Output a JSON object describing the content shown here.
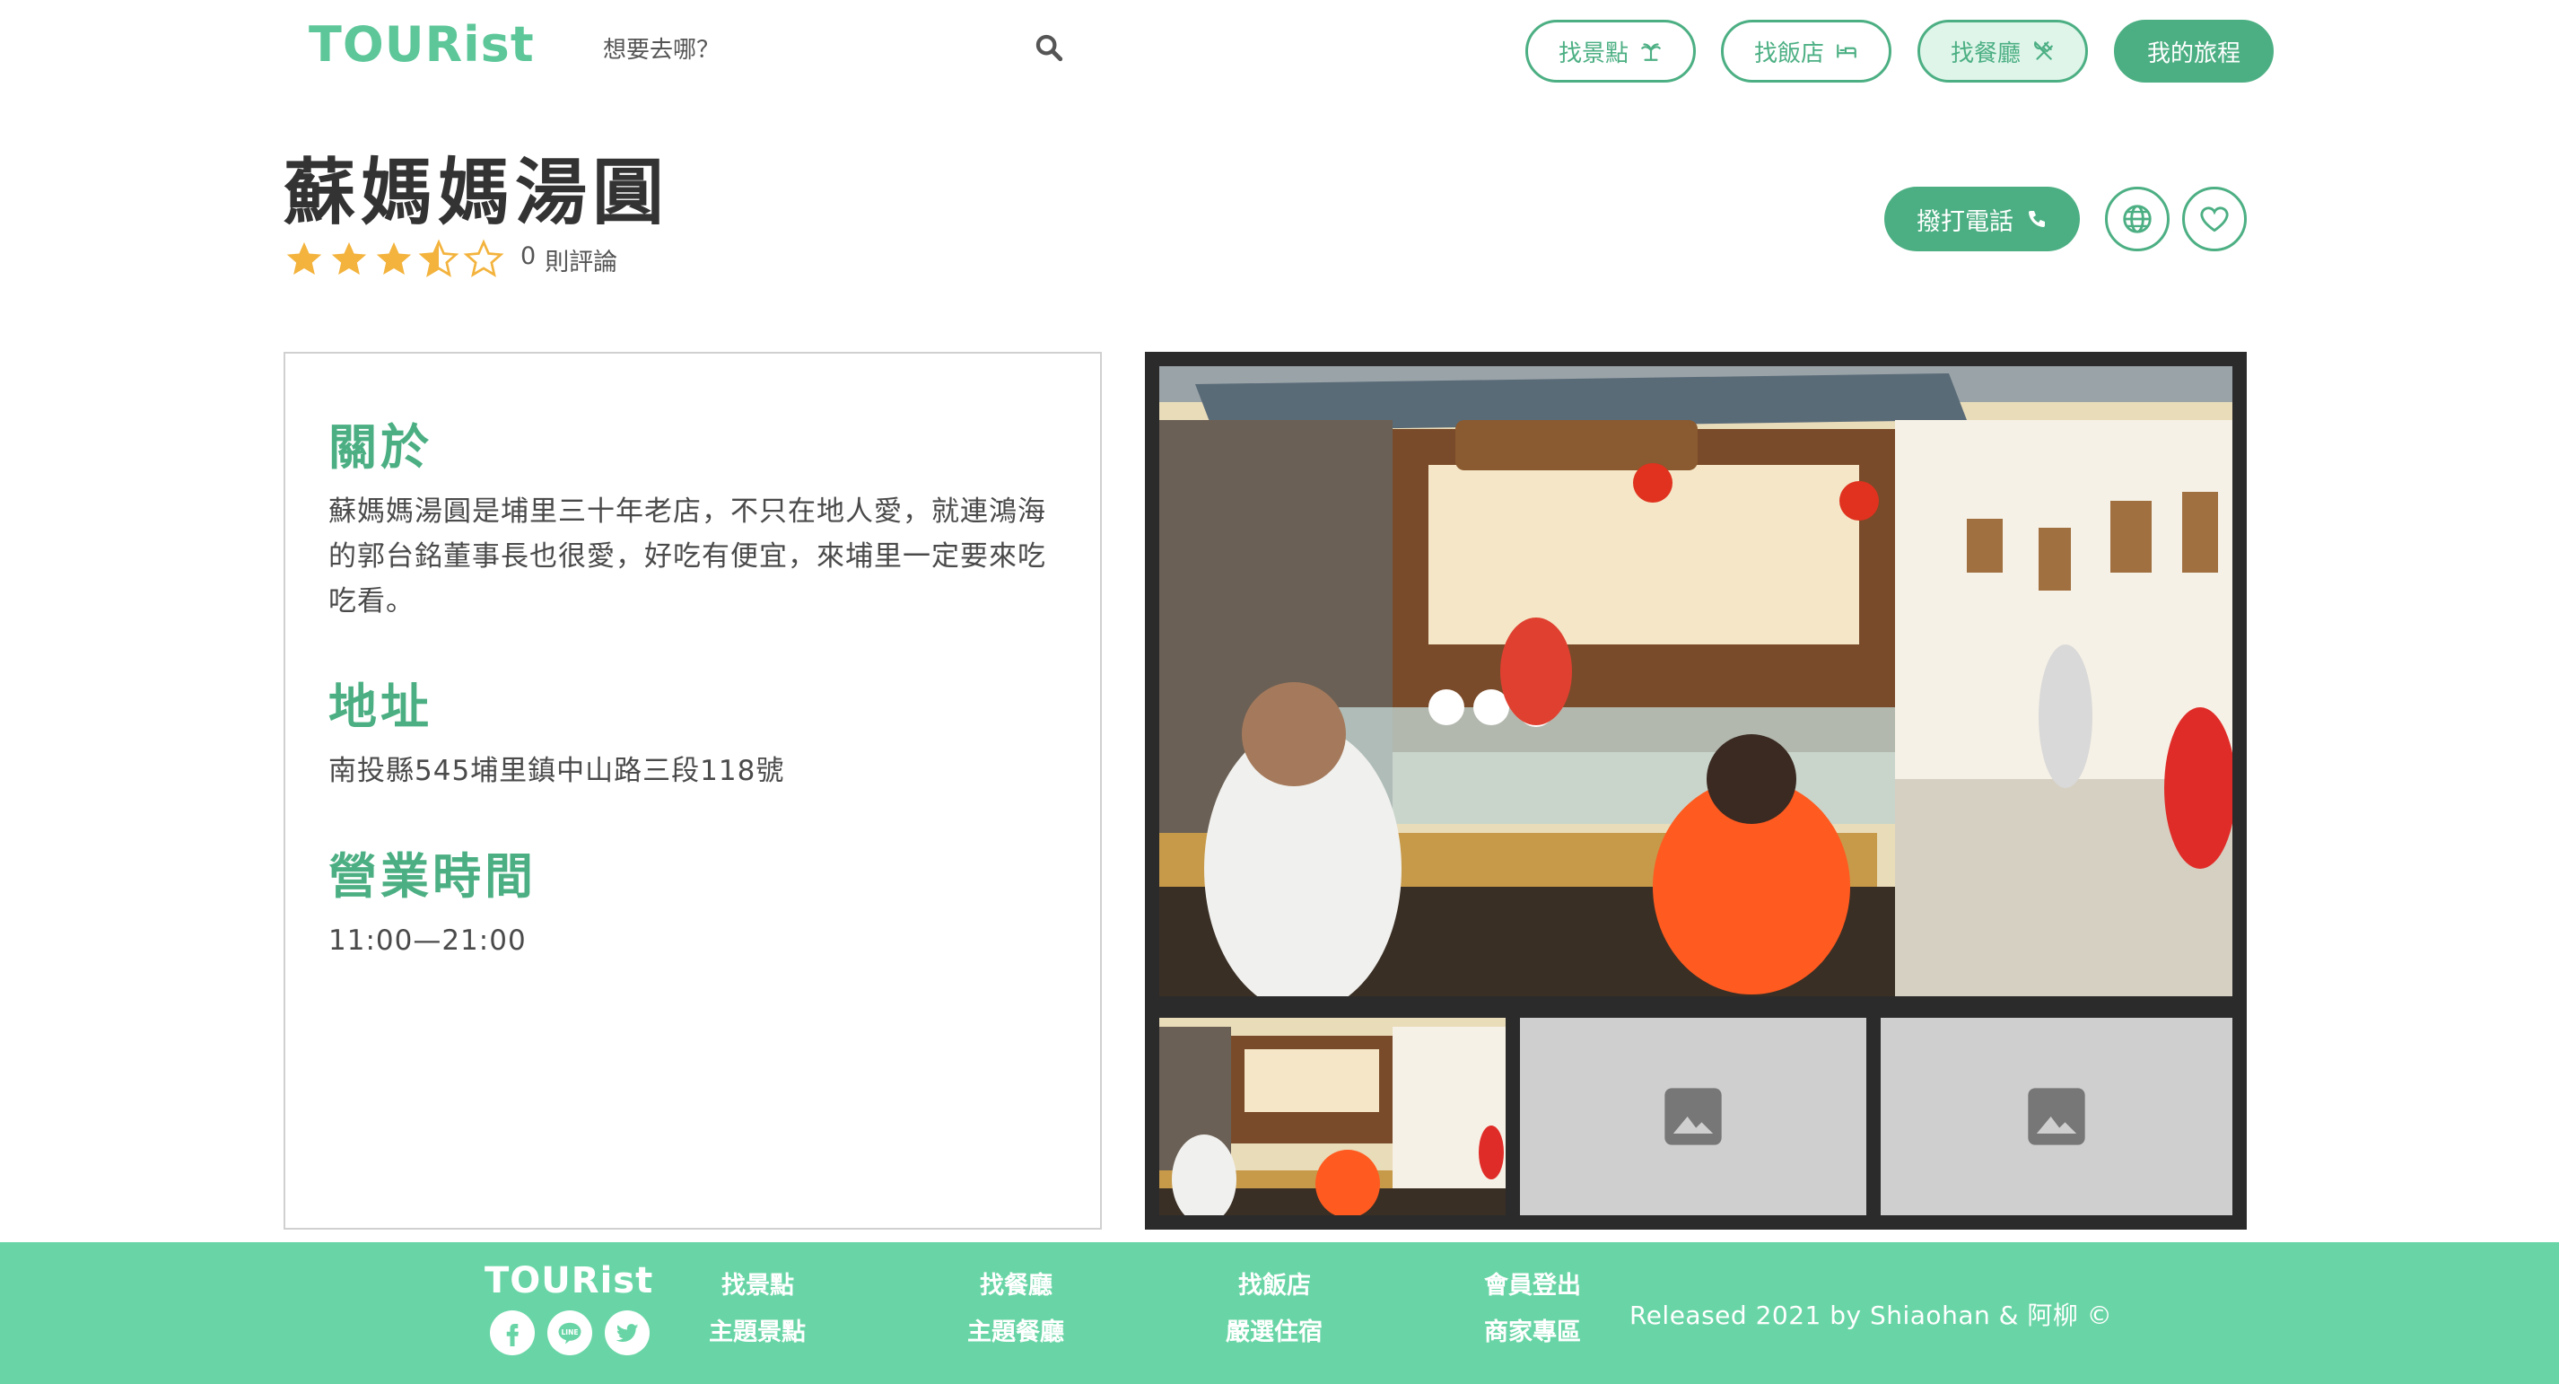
{
  "header": {
    "logo": "TOURist",
    "search_placeholder": "想要去哪？",
    "nav": [
      {
        "label": "找景點",
        "icon": "palm-tree-icon"
      },
      {
        "label": "找飯店",
        "icon": "bed-icon"
      },
      {
        "label": "找餐廳",
        "icon": "utensils-icon"
      },
      {
        "label": "我的旅程"
      }
    ]
  },
  "place": {
    "name": "蘇媽媽湯圓",
    "rating": 3.5,
    "review_count": "0",
    "review_label": "則評論",
    "call_label": "撥打電話"
  },
  "info": {
    "about_title": "關於",
    "about_text": "蘇媽媽湯圓是埔里三十年老店，不只在地人愛，就連鴻海的郭台銘董事長也很愛，好吃有便宜，來埔里一定要來吃吃看。",
    "address_title": "地址",
    "address": "南投縣545埔里鎮中山路三段118號",
    "hours_title": "營業時間",
    "hours": "11:00—21:00"
  },
  "footer": {
    "logo": "TOURist",
    "links": [
      "找景點",
      "主題景點",
      "找餐廳",
      "主題餐廳",
      "找飯店",
      "嚴選住宿",
      "會員登出",
      "商家專區"
    ],
    "credit": "Released 2021 by Shiaohan & 阿柳 ©"
  },
  "colors": {
    "brand": "#4caf83",
    "logo": "#5ec79a",
    "footer": "#69d5a6",
    "star": "#f3b33d"
  }
}
